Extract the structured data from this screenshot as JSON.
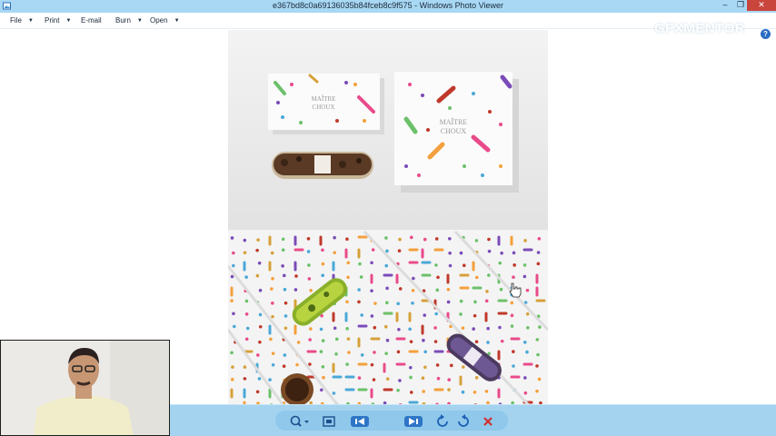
{
  "window": {
    "title": "e367bd8c0a69136035b84fceb8c9f575 - Windows Photo Viewer",
    "buttons": {
      "minimize": "–",
      "maximize": "❐",
      "close": "✕"
    }
  },
  "menu": {
    "items": [
      {
        "label": "File",
        "has_dropdown": true
      },
      {
        "label": "Print",
        "has_dropdown": true
      },
      {
        "label": "E-mail",
        "has_dropdown": false
      },
      {
        "label": "Burn",
        "has_dropdown": true
      },
      {
        "label": "Open",
        "has_dropdown": true
      }
    ],
    "dropdown_glyph": "▼",
    "help_glyph": "?"
  },
  "watermark": {
    "part1": "GFX",
    "part2": "MENTOR"
  },
  "photo": {
    "box_brand_lines": [
      "MAÎTRE",
      "CHOUX"
    ],
    "sprinkle_colors": [
      "#e94b8a",
      "#6cc16a",
      "#f4a03c",
      "#7b4cb8",
      "#d6a13a",
      "#4aa8d8",
      "#c0392b"
    ]
  },
  "toolbar": {
    "icons": [
      "zoom-icon",
      "actual-size-icon",
      "previous-icon",
      "slideshow-icon",
      "next-icon",
      "rotate-left-icon",
      "rotate-right-icon",
      "delete-icon"
    ]
  },
  "colors": {
    "titlebar": "#a8d8f4",
    "toolbar": "#a3d3ef",
    "close_button": "#c9463d",
    "delete_red": "#d22f2f"
  }
}
